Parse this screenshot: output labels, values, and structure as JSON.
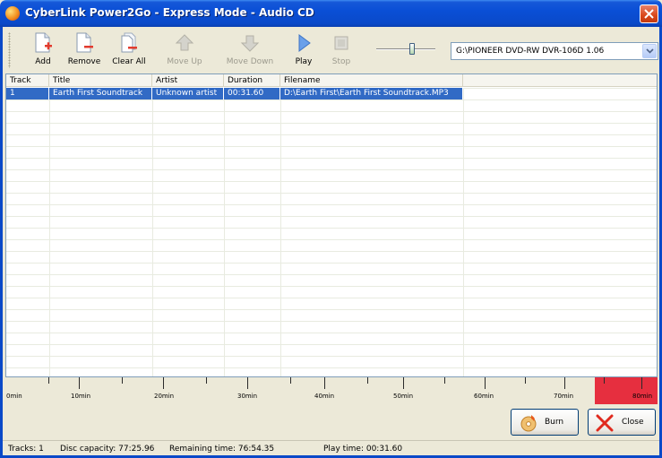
{
  "window": {
    "title": "CyberLink Power2Go - Express Mode - Audio CD",
    "app_icon": "power2go-icon",
    "close_icon": "close-icon"
  },
  "toolbar": {
    "buttons": [
      {
        "label": "Add",
        "icon": "add-file-icon",
        "enabled": true
      },
      {
        "label": "Remove",
        "icon": "remove-file-icon",
        "enabled": true
      },
      {
        "label": "Clear All",
        "icon": "clear-all-icon",
        "enabled": true
      },
      {
        "label": "Move Up",
        "icon": "move-up-icon",
        "enabled": false
      },
      {
        "label": "Move Down",
        "icon": "move-down-icon",
        "enabled": false
      },
      {
        "label": "Play",
        "icon": "play-icon",
        "enabled": true
      },
      {
        "label": "Stop",
        "icon": "stop-icon",
        "enabled": false
      }
    ],
    "volume_slider": {
      "level": 0.6
    },
    "drive": {
      "selected": "G:\\PIONEER DVD-RW DVR-106D 1.06"
    }
  },
  "table": {
    "columns": [
      "Track",
      "Title",
      "Artist",
      "Duration",
      "Filename"
    ],
    "rows": [
      {
        "track": "1",
        "title": "Earth First Soundtrack",
        "artist": "Unknown artist",
        "duration": "00:31.60",
        "filename": "D:\\Earth First\\Earth First Soundtrack.MP3",
        "selected": true
      }
    ]
  },
  "capacity": {
    "labels": [
      "0min",
      "10min",
      "20min",
      "30min",
      "40min",
      "50min",
      "60min",
      "70min",
      "80min"
    ],
    "colors": {
      "used": "#9bb8e6",
      "over": "#e62f3f"
    }
  },
  "actions": {
    "burn_label": "Burn",
    "close_label": "Close"
  },
  "status": {
    "tracks": "Tracks: 1",
    "disc_capacity": "Disc capacity: 77:25.96",
    "remaining_time": "Remaining time: 76:54.35",
    "play_time": "Play time: 00:31.60"
  }
}
